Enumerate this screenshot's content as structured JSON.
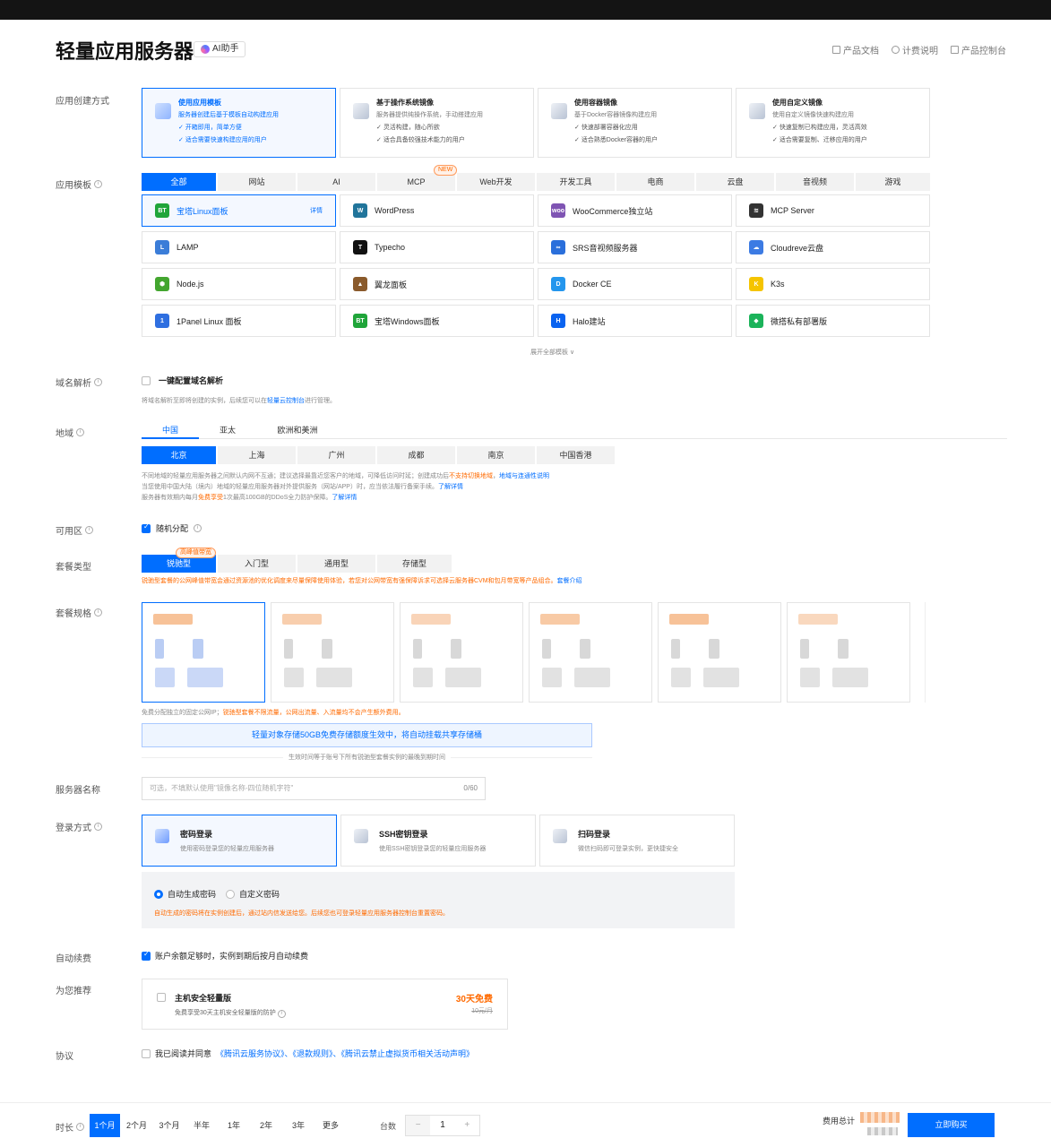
{
  "header": {
    "title": "轻量应用服务器",
    "ai_label": "AI助手",
    "links": [
      "产品文档",
      "计费说明",
      "产品控制台"
    ]
  },
  "labels": {
    "mode": "应用创建方式",
    "template": "应用模板",
    "domain": "域名解析",
    "region": "地域",
    "zone": "可用区",
    "plan_type": "套餐类型",
    "plan_spec": "套餐规格",
    "server_name": "服务器名称",
    "login": "登录方式",
    "auto_renew": "自动续费",
    "recommend": "为您推荐",
    "agreement": "协议"
  },
  "modes": [
    {
      "title": "使用应用模板",
      "sub": "服务器创建后基于模板自动构建应用",
      "b1": "开箱即用，简单方便",
      "b2": "适合需要快速构建应用的用户"
    },
    {
      "title": "基于操作系统镜像",
      "sub": "服务器提供纯操作系统，手动搭建应用",
      "b1": "灵活构建，随心所欲",
      "b2": "适合具备较强技术能力的用户"
    },
    {
      "title": "使用容器镜像",
      "sub": "基于Docker容器镜像构建应用",
      "b1": "快速部署容器化应用",
      "b2": "适合熟悉Docker容器的用户"
    },
    {
      "title": "使用自定义镜像",
      "sub": "使用自定义镜像快速构建应用",
      "b1": "快速复制已构建应用，灵活高效",
      "b2": "适合需要复制、迁移应用的用户"
    }
  ],
  "template_tabs": [
    "全部",
    "网站",
    "AI",
    "MCP",
    "Web开发",
    "开发工具",
    "电商",
    "云盘",
    "音视频",
    "游戏"
  ],
  "new_badge": "NEW",
  "templates": [
    {
      "name": "宝塔Linux面板",
      "logo": "BT",
      "color": "#20a53a"
    },
    {
      "name": "WordPress",
      "logo": "W",
      "color": "#21759b"
    },
    {
      "name": "WooCommerce独立站",
      "logo": "woo",
      "color": "#7f54b3"
    },
    {
      "name": "MCP Server",
      "logo": "≋",
      "color": "#333333"
    },
    {
      "name": "LAMP",
      "logo": "L",
      "color": "#3b7dd8"
    },
    {
      "name": "Typecho",
      "logo": "T",
      "color": "#111111"
    },
    {
      "name": "SRS音视频服务器",
      "logo": "∞",
      "color": "#2a6fdb"
    },
    {
      "name": "Cloudreve云盘",
      "logo": "☁",
      "color": "#3c7be3"
    },
    {
      "name": "Node.js",
      "logo": "⬢",
      "color": "#43a62f"
    },
    {
      "name": "翼龙面板",
      "logo": "▲",
      "color": "#8a5a2b"
    },
    {
      "name": "Docker CE",
      "logo": "D",
      "color": "#2496ed"
    },
    {
      "name": "K3s",
      "logo": "K",
      "color": "#f5c400"
    },
    {
      "name": "1Panel Linux 面板",
      "logo": "1",
      "color": "#2f6fe0"
    },
    {
      "name": "宝塔Windows面板",
      "logo": "BT",
      "color": "#20a53a"
    },
    {
      "name": "Halo建站",
      "logo": "H",
      "color": "#0a63f0"
    },
    {
      "name": "微搭私有部署版",
      "logo": "◆",
      "color": "#1bb35a"
    }
  ],
  "template_detail": "详情",
  "expand_all": "展开全部模板 ∨",
  "domain": {
    "checkbox": "一键配置域名解析",
    "note_pre": "将域名解析至即将创建的实例，后续您可以在",
    "note_link": "轻量云控制台",
    "note_post": "进行管理。"
  },
  "region_groups": [
    "中国",
    "亚太",
    "欧洲和美洲"
  ],
  "cities": [
    "北京",
    "上海",
    "广州",
    "成都",
    "南京",
    "中国香港"
  ],
  "region_notes": {
    "l1_pre": "不同地域的轻量应用服务器之间默认内网不互通；建议选择最靠近您客户的地域，可降低访问时延；创建成功后",
    "l1_warn": "不支持切换地域",
    "l1_sep": "，",
    "l1_link": "地域与连通性说明",
    "l2_pre": "当您使用中国大陆（境内）地域的轻量应用服务器对外提供服务（网站/APP）时，应当依法履行备案手续。",
    "l2_link": "了解详情",
    "l3_pre": "服务器有效期内每月",
    "l3_warn": "免费享受",
    "l3_mid": "1次最高100GB的DDoS全力防护保障。",
    "l3_link": "了解详情"
  },
  "zone": {
    "label": "随机分配"
  },
  "plan_types": [
    "锐驰型",
    "入门型",
    "通用型",
    "存储型"
  ],
  "plan_badge": "高峰值带宽",
  "plan_note": {
    "text": "锐驰型套餐的公网峰值带宽会通过资源池的优化调度来尽量保障使用体验，若您对公网带宽有强保障诉求可选择云服务器CVM和包月带宽等产品组合。",
    "link": "套餐介绍"
  },
  "spec_note": {
    "pre": "免费分配独立的固定公网IP；",
    "warn": "锐驰型套餐不限流量，公网出流量、入流量均不会产生额外费用。"
  },
  "banner": "轻量对象存储50GB免费存储额度生效中，将自动挂载共享存储桶",
  "banner_sub": "生效时间等于账号下所有锐驰型套餐实例的最晚到期时间",
  "server_name": {
    "placeholder": "可选，不填默认使用\"镜像名称-四位随机字符\"",
    "counter": "0/60"
  },
  "login_methods": [
    {
      "title": "密码登录",
      "sub": "使用密码登录您的轻量应用服务器"
    },
    {
      "title": "SSH密钥登录",
      "sub": "使用SSH密钥登录您的轻量应用服务器"
    },
    {
      "title": "扫码登录",
      "sub": "微信扫码即可登录实例，更快捷安全"
    }
  ],
  "pwd": {
    "auto": "自动生成密码",
    "custom": "自定义密码",
    "note": "自动生成的密码将在实例创建后，通过站内信发送给您。后续您也可登录轻量应用服务器控制台重置密码。"
  },
  "auto_renew": "账户余额足够时，实例到期后按月自动续费",
  "recommend": {
    "title": "主机安全轻量版",
    "sub": "免费享受30天主机安全轻量版的防护",
    "promo": "30天免费",
    "old_price": "10元/月"
  },
  "agreement": {
    "pre": "我已阅读并同意",
    "links": "《腾讯云服务协议》、《退款规则》、《腾讯云禁止虚拟货币相关活动声明》"
  },
  "footer": {
    "duration_label": "时长",
    "durations": [
      "1个月",
      "2个月",
      "3个月",
      "半年",
      "1年",
      "2年",
      "3年",
      "更多"
    ],
    "qty_label": "台数",
    "minus": "−",
    "qty": "1",
    "plus": "+",
    "total_label": "费用总计",
    "buy": "立即购买"
  },
  "colors": {
    "accent": "#006eff",
    "warn": "#ff6a00"
  }
}
